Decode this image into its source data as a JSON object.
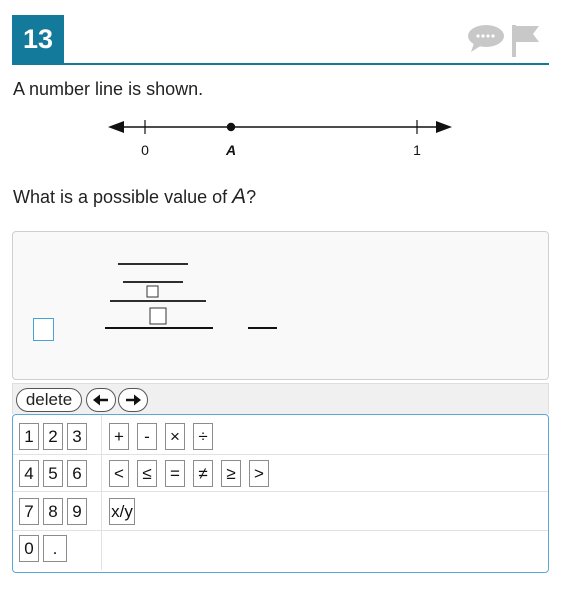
{
  "question": {
    "number": "13",
    "prompt": "A number line is shown.",
    "question_prefix": "What is a possible value of ",
    "question_var": "A",
    "question_suffix": "?"
  },
  "number_line": {
    "labels": [
      "0",
      "A",
      "1"
    ],
    "point_label": "A"
  },
  "header_icons": {
    "comment": "comment-icon",
    "flag": "flag-icon"
  },
  "toolbar": {
    "delete_label": "delete",
    "left_icon": "left-arrow-icon",
    "right_icon": "right-arrow-icon"
  },
  "keypad": {
    "digits": [
      "1",
      "2",
      "3",
      "4",
      "5",
      "6",
      "7",
      "8",
      "9",
      "0",
      "."
    ],
    "operators": [
      "+",
      "-",
      "×",
      "÷"
    ],
    "comparators": [
      "<",
      "≤",
      "=",
      "≠",
      "≥",
      ">"
    ],
    "fraction": "x/y"
  },
  "colors": {
    "accent": "#137a9b",
    "focus": "#49a3d4",
    "icon_gray": "#c8c8c8"
  }
}
